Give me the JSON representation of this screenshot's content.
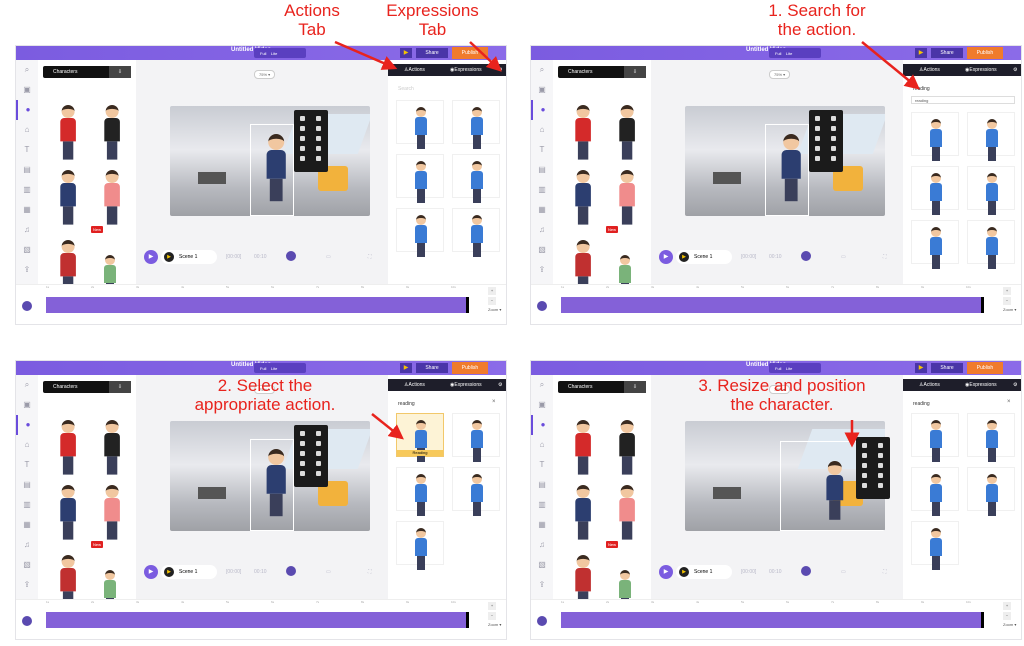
{
  "annotations": {
    "actions_tab": "Actions\nTab",
    "expressions_tab": "Expressions\nTab",
    "step1": "1. Search for\nthe action.",
    "step2": "2. Select the\nappropriate action.",
    "step3": "3. Resize and position\nthe character."
  },
  "app": {
    "title": "Untitled Video",
    "seg_left": "Full",
    "seg_right": "Lite",
    "share": "Share",
    "publish": "Publish",
    "characters_tab": "Characters",
    "zoom_pill": "75% ▾",
    "actions_tab": "Actions",
    "expressions_tab": "Expressions",
    "new_badge": "New",
    "scene": "Scene 1",
    "time_start": "[00:00]",
    "time_end": "00:10",
    "ruler": [
      "1s",
      "2s",
      "3s",
      "4s",
      "5s",
      "6s",
      "7s",
      "8s",
      "9s",
      "10s"
    ],
    "zoom_label": "Zoom ▾"
  },
  "panels": [
    {
      "search": "",
      "search_placeholder": "Search",
      "suggestion": null,
      "highlight_label": null,
      "cells": 6
    },
    {
      "search": "reading",
      "suggestion": "reading",
      "highlight_label": null,
      "cells": 6
    },
    {
      "search": "reading",
      "suggestion": null,
      "clear": "×",
      "highlight_label": "Reading",
      "cells": 5
    },
    {
      "search": "reading",
      "suggestion": null,
      "clear": "×",
      "highlight_label": null,
      "cells": 5
    }
  ],
  "colors": {
    "accent": "#7b5ce0",
    "annotation": "#e8231d",
    "publish": "#f07b2c"
  }
}
